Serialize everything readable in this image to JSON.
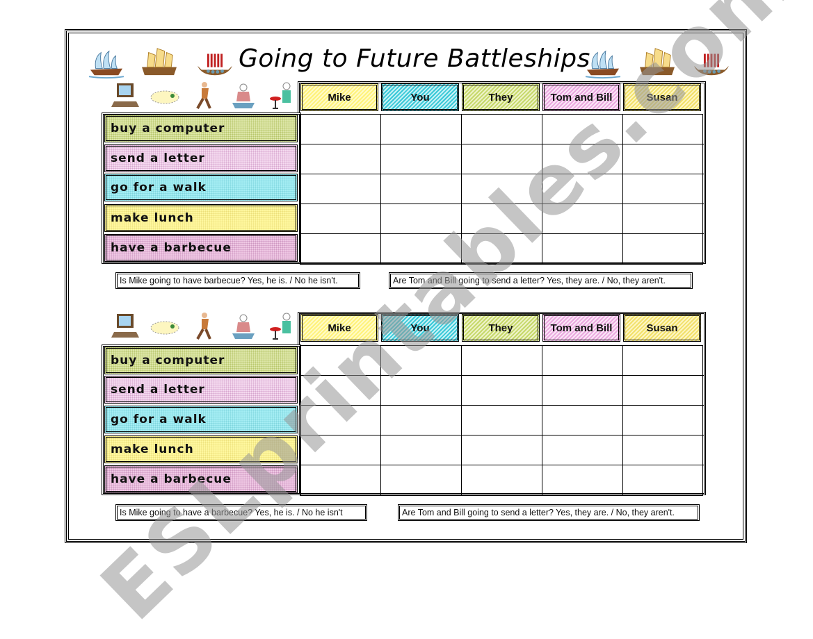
{
  "title": "Going to Future Battleships",
  "ships_left": [
    "galleon-ship-icon",
    "junk-ship-icon",
    "viking-ship-icon"
  ],
  "ships_right": [
    "galleon-ship-icon",
    "junk-ship-icon",
    "viking-ship-icon"
  ],
  "activity_icons": [
    "computer-icon",
    "letter-map-icon",
    "walking-man-icon",
    "cook-icon",
    "barbecue-chef-icon"
  ],
  "grids": [
    {
      "columns": [
        "Mike",
        "You",
        "They",
        "Tom and Bill",
        "Susan"
      ],
      "rows": [
        "buy a computer",
        "send a letter",
        "go for a walk",
        "make lunch",
        "have a barbecue"
      ],
      "examples": [
        "Is Mike going to have barbecue? Yes, he is. / No he isn't.",
        "Are Tom and Bill going to send a letter? Yes, they are. / No, they aren't."
      ]
    },
    {
      "columns": [
        "Mike",
        "You",
        "They",
        "Tom and Bill",
        "Susan"
      ],
      "rows": [
        "buy a computer",
        "send a letter",
        "go for a walk",
        "make lunch",
        "have a barbecue"
      ],
      "examples": [
        "Is Mike going to have a barbecue? Yes, he is. / No he isn't",
        "Are Tom and Bill going to send a letter? Yes, they are. / No, they aren't."
      ]
    }
  ],
  "watermark": "ESLprintables.com"
}
